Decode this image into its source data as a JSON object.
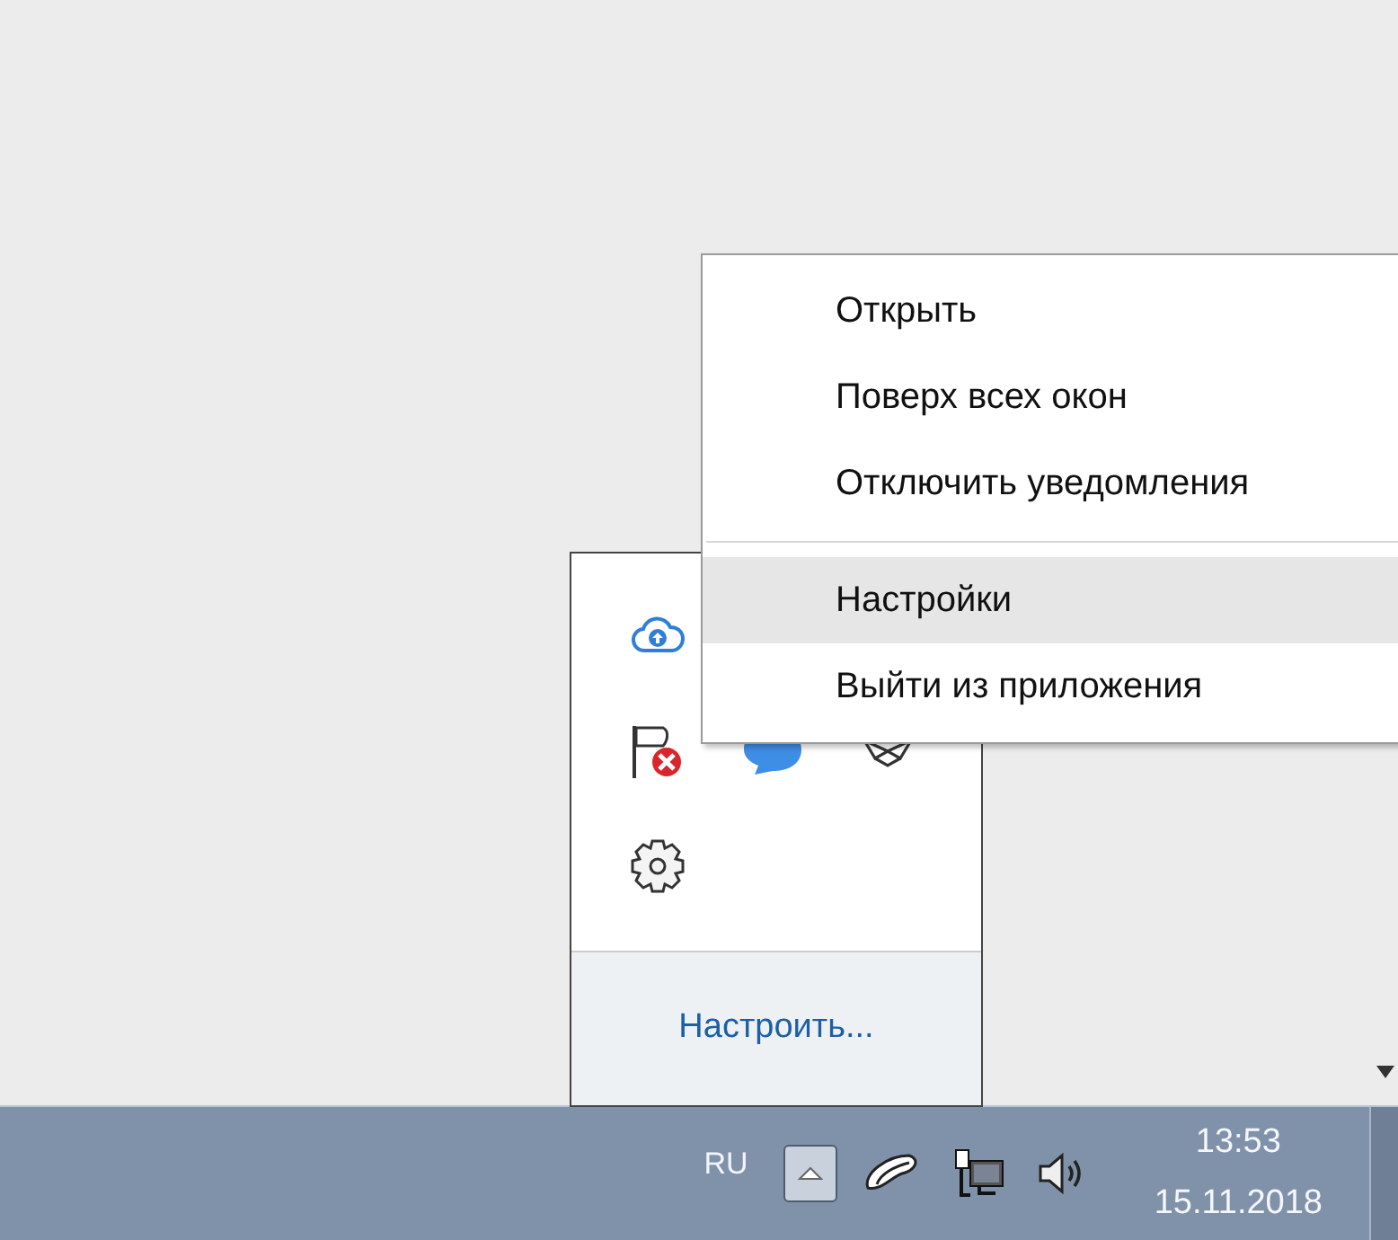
{
  "context_menu": {
    "items": [
      {
        "kind": "item",
        "label": "Открыть",
        "selected": false
      },
      {
        "kind": "item",
        "label": "Поверх всех окон",
        "selected": false
      },
      {
        "kind": "item",
        "label": "Отключить уведомления",
        "selected": false
      },
      {
        "kind": "separator"
      },
      {
        "kind": "item",
        "label": "Настройки",
        "selected": true
      },
      {
        "kind": "item",
        "label": "Выйти из приложения",
        "selected": false
      }
    ]
  },
  "tray_popup": {
    "customize_link": "Настроить..."
  },
  "taskbar": {
    "language": "RU",
    "time": "13:53",
    "date": "15.11.2018"
  }
}
